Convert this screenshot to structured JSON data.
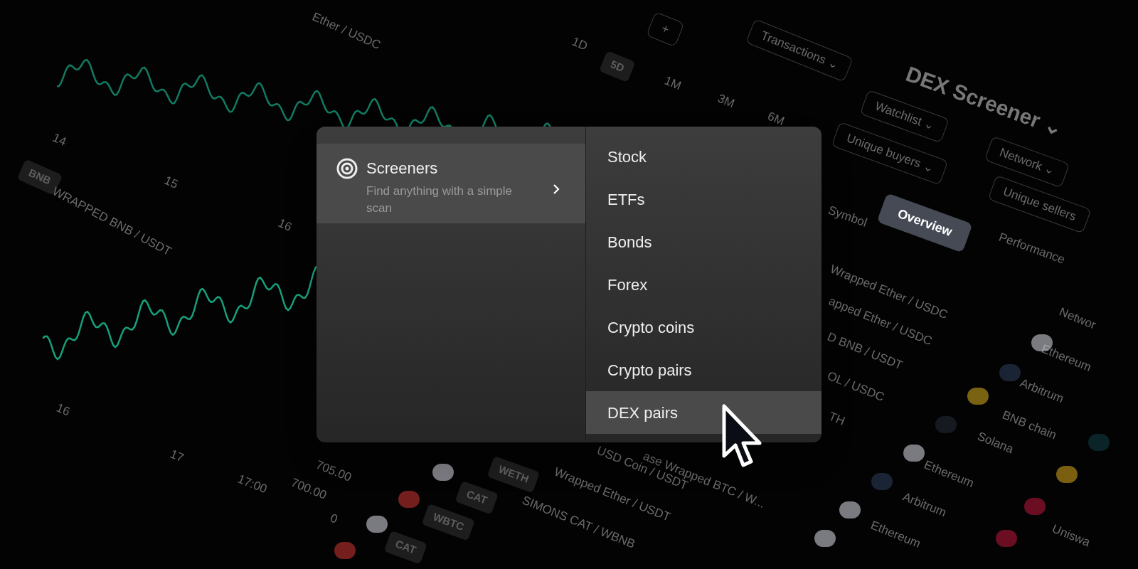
{
  "background": {
    "labels": [
      {
        "text": "Ether / USDC",
        "kind": "plain"
      },
      {
        "text": "14",
        "kind": "plain"
      },
      {
        "text": "15",
        "kind": "plain"
      },
      {
        "text": "16",
        "kind": "plain"
      },
      {
        "text": "BNB",
        "kind": "badge"
      },
      {
        "text": "WRAPPED BNB / USDT",
        "kind": "plain"
      },
      {
        "text": "16",
        "kind": "plain"
      },
      {
        "text": "17",
        "kind": "plain"
      },
      {
        "text": "17:00",
        "kind": "plain"
      },
      {
        "text": "705.00",
        "kind": "plain"
      },
      {
        "text": "700.00",
        "kind": "plain"
      },
      {
        "text": "0",
        "kind": "plain"
      },
      {
        "text": "1D",
        "kind": "plain"
      },
      {
        "text": "5D",
        "kind": "badge"
      },
      {
        "text": "1M",
        "kind": "plain"
      },
      {
        "text": "3M",
        "kind": "plain"
      },
      {
        "text": "6M",
        "kind": "plain"
      },
      {
        "text": "+",
        "kind": "chip"
      },
      {
        "text": "Transactions ⌄",
        "kind": "chip"
      },
      {
        "text": "DEX Screener ⌄",
        "kind": "title"
      },
      {
        "text": "Watchlist ⌄",
        "kind": "chip"
      },
      {
        "text": "Unique buyers ⌄",
        "kind": "chip"
      },
      {
        "text": "Network ⌄",
        "kind": "chip"
      },
      {
        "text": "Unique sellers",
        "kind": "chip"
      },
      {
        "text": "Overview",
        "kind": "chip_active"
      },
      {
        "text": "Performance",
        "kind": "plain"
      },
      {
        "text": "Symbol",
        "kind": "plain"
      },
      {
        "text": "Wrapped Ether / USDC",
        "kind": "plain"
      },
      {
        "text": "apped Ether / USDC",
        "kind": "plain"
      },
      {
        "text": "D BNB / USDT",
        "kind": "plain"
      },
      {
        "text": "OL / USDC",
        "kind": "plain"
      },
      {
        "text": "TH",
        "kind": "plain"
      },
      {
        "text": "Networ",
        "kind": "plain"
      },
      {
        "text": "Ethereum",
        "kind": "plain"
      },
      {
        "text": "Arbitrum",
        "kind": "plain"
      },
      {
        "text": "BNB chain",
        "kind": "plain"
      },
      {
        "text": "Solana",
        "kind": "plain"
      },
      {
        "text": "Ethereum",
        "kind": "plain"
      },
      {
        "text": "Arbitrum",
        "kind": "plain"
      },
      {
        "text": "Ethereum",
        "kind": "plain"
      },
      {
        "text": "Uniswa",
        "kind": "plain"
      },
      {
        "text": "ase Wrapped BTC / W...",
        "kind": "plain"
      },
      {
        "text": "USD Coin / USDT",
        "kind": "plain"
      },
      {
        "text": "Wrapped Ether / USDT",
        "kind": "plain"
      },
      {
        "text": "SIMONS CAT / WBNB",
        "kind": "plain"
      },
      {
        "text": "WETH",
        "kind": "badge"
      },
      {
        "text": "CAT",
        "kind": "badge"
      },
      {
        "text": "WBTC",
        "kind": "badge"
      },
      {
        "text": "CAT",
        "kind": "badge"
      }
    ]
  },
  "menu": {
    "categories": [
      {
        "title": "Screeners",
        "subtitle": "Find anything with a simple scan",
        "selected": true
      }
    ],
    "items": [
      {
        "label": "Stock",
        "selected": false
      },
      {
        "label": "ETFs",
        "selected": false
      },
      {
        "label": "Bonds",
        "selected": false
      },
      {
        "label": "Forex",
        "selected": false
      },
      {
        "label": "Crypto coins",
        "selected": false
      },
      {
        "label": "Crypto pairs",
        "selected": false
      },
      {
        "label": "DEX pairs",
        "selected": true
      }
    ]
  }
}
